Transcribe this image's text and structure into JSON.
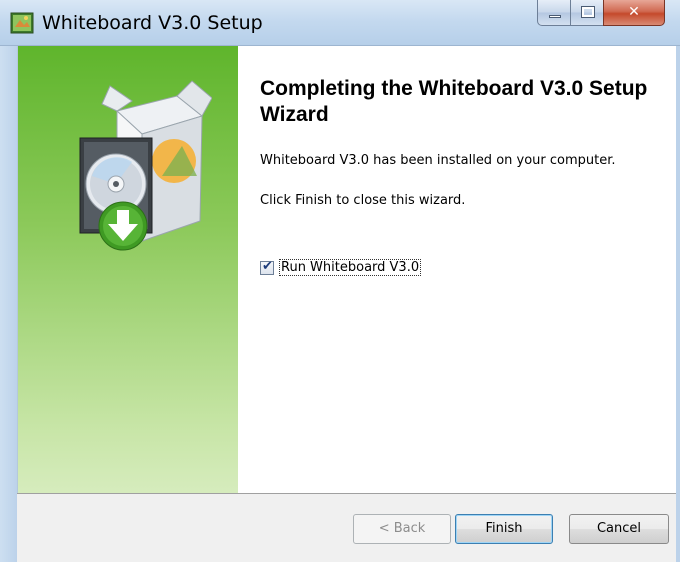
{
  "window": {
    "title": "Whiteboard V3.0 Setup"
  },
  "caption_buttons": {
    "minimize": "minimize",
    "maximize": "maximize",
    "close": "close"
  },
  "content": {
    "heading": "Completing the Whiteboard V3.0 Setup Wizard",
    "installed_text": "Whiteboard V3.0 has been installed on your computer.",
    "instruction_text": "Click Finish to close this wizard.",
    "run_checkbox": {
      "label": "Run Whiteboard V3.0",
      "checked": true
    }
  },
  "buttons": {
    "back": "< Back",
    "finish": "Finish",
    "cancel": "Cancel"
  },
  "colors": {
    "side_panel_top": "#5fb52c",
    "side_panel_bottom": "#d6ecbd",
    "finish_border": "#3c7fb1"
  }
}
